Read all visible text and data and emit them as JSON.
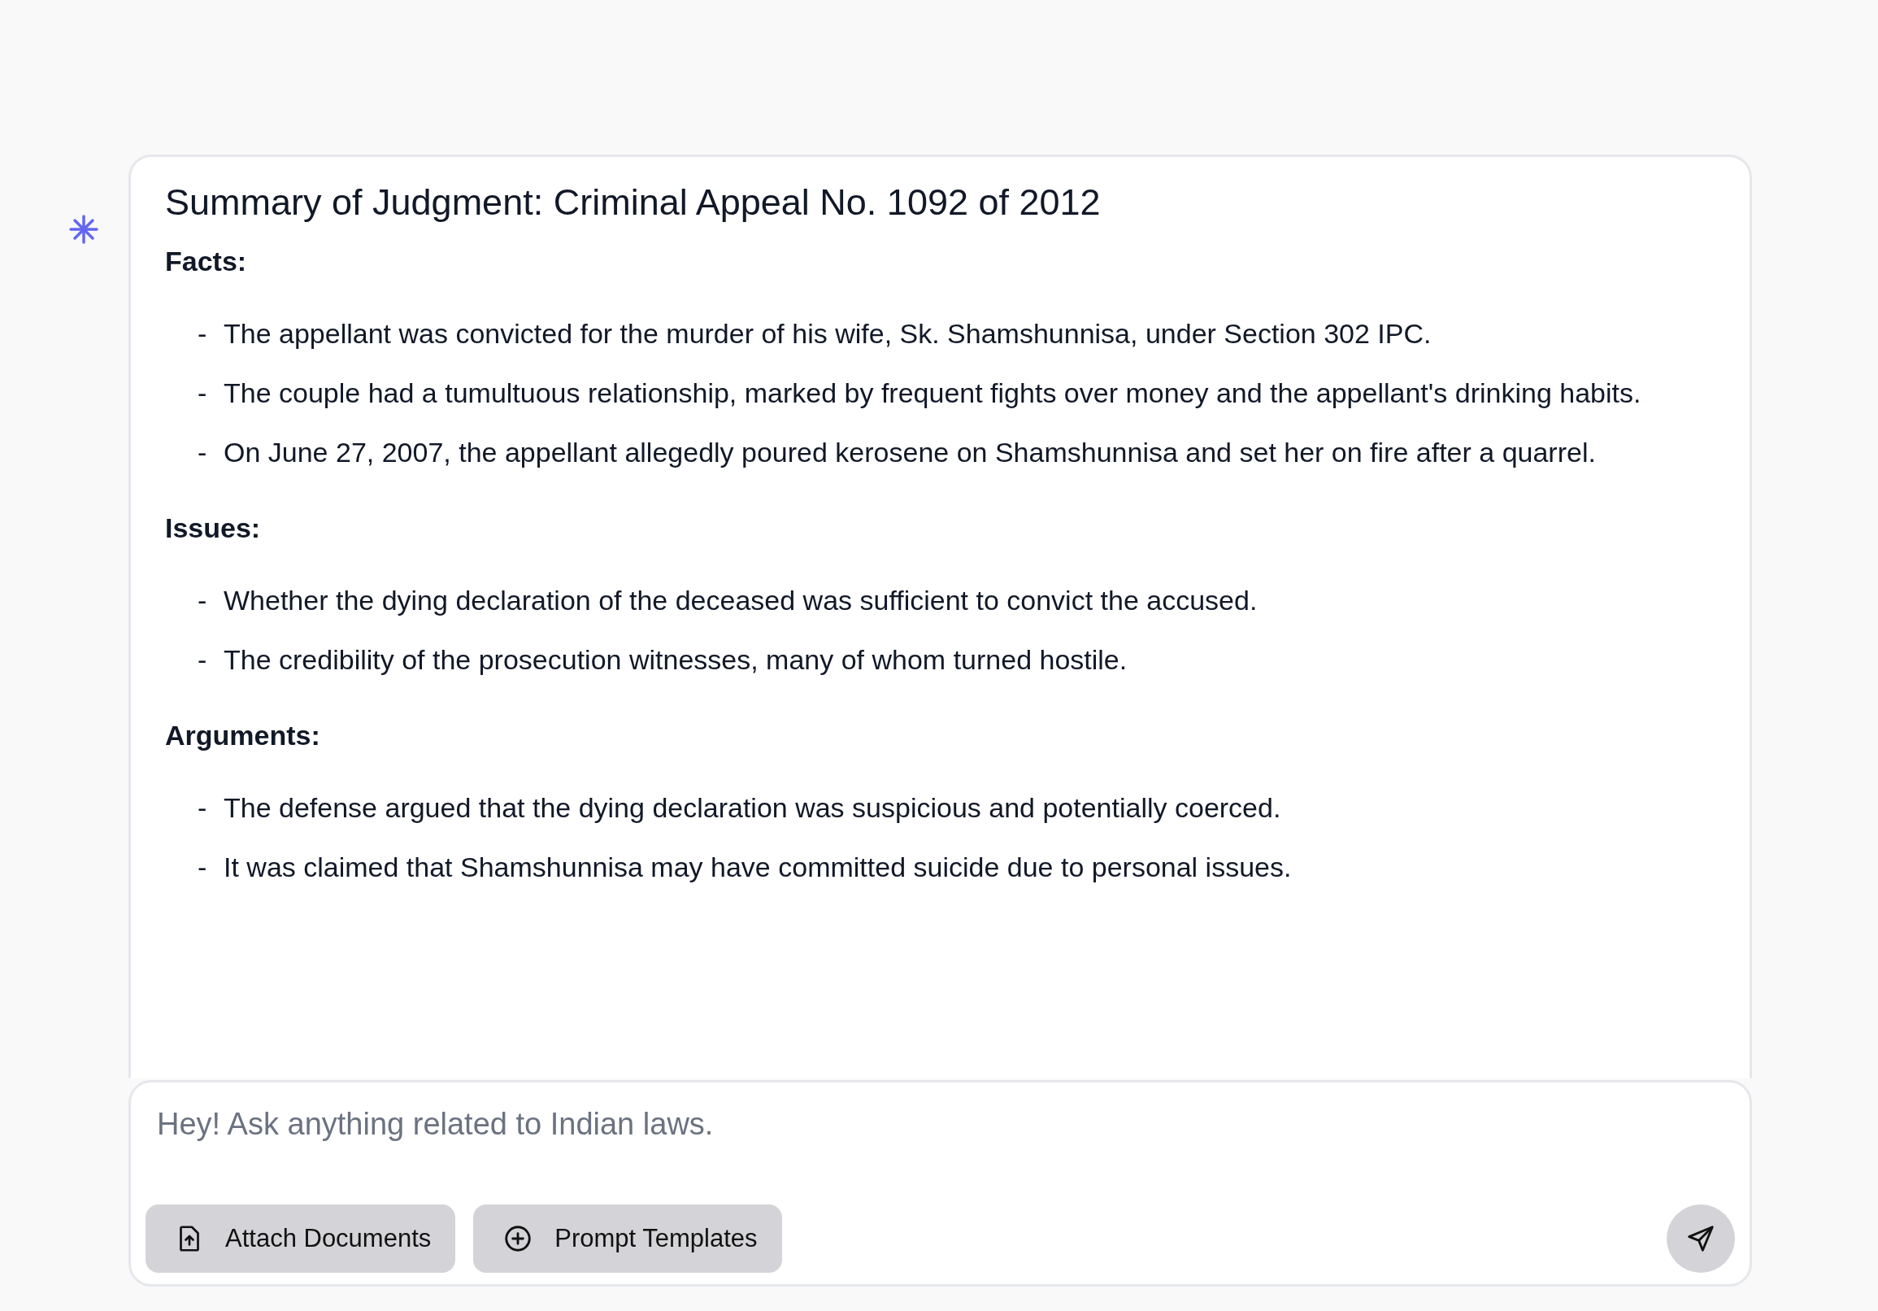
{
  "message": {
    "title": "Summary of Judgment: Criminal Appeal No. 1092 of 2012",
    "sections": [
      {
        "heading": "Facts:",
        "items": [
          {
            "marker": "-",
            "text": "The appellant was convicted for the murder of his wife, Sk. Shamshunnisa, under Section 302 IPC."
          },
          {
            "marker": "-",
            "text": "The couple had a tumultuous relationship, marked by frequent fights over money and the appellant's drinking habits."
          },
          {
            "marker": "-",
            "text": "On June 27, 2007, the appellant allegedly poured kerosene on Shamshunnisa and set her on fire after a quarrel."
          }
        ]
      },
      {
        "heading": "Issues:",
        "items": [
          {
            "marker": "-",
            "text": "Whether the dying declaration of the deceased was sufficient to convict the accused."
          },
          {
            "marker": "-",
            "text": "The credibility of the prosecution witnesses, many of whom turned hostile."
          }
        ]
      },
      {
        "heading": "Arguments:",
        "items": [
          {
            "marker": "-",
            "text": "The defense argued that the dying declaration was suspicious and potentially coerced."
          },
          {
            "marker": "-",
            "text": "It was claimed that Shamshunnisa may have committed suicide due to personal issues."
          }
        ]
      }
    ]
  },
  "composer": {
    "placeholder": "Hey! Ask anything related to Indian laws.",
    "buttons": [
      {
        "kind": "attach",
        "label": "Attach Documents"
      },
      {
        "kind": "templates",
        "label": "Prompt Templates"
      }
    ]
  }
}
